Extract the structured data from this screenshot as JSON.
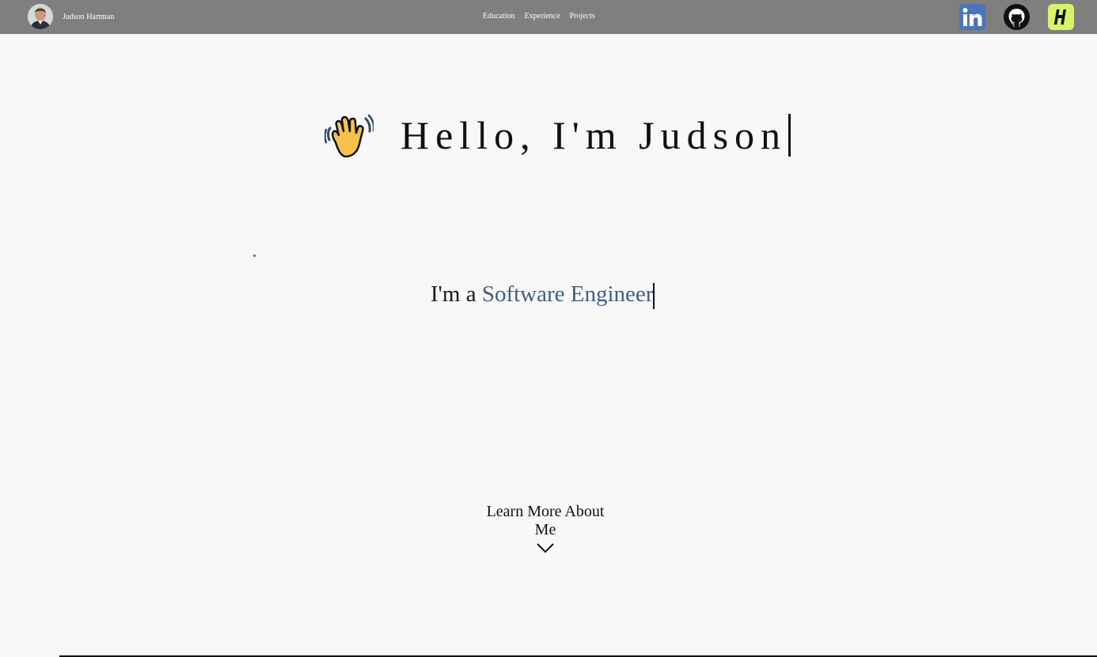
{
  "navbar": {
    "brand_name": "Judson Hartman",
    "links": [
      {
        "label": "Education"
      },
      {
        "label": "Experience"
      },
      {
        "label": "Projects"
      }
    ],
    "social_icons": [
      "linkedin-icon",
      "github-icon",
      "handshake-icon"
    ],
    "background": "#7f7f7f"
  },
  "hero": {
    "greeting": "Hello, I'm Judson",
    "wave_icon": "waving-hand-icon",
    "subtitle_prefix": "I'm a ",
    "subtitle_role": "Software Engineer",
    "role_color": "#3f5f86"
  },
  "cta": {
    "label": "Learn More About Me",
    "icon": "chevron-down-icon"
  },
  "colors": {
    "page_background": "#f8f8f8",
    "linkedin": "#4a76b6",
    "handshake": "#d8f36a"
  }
}
